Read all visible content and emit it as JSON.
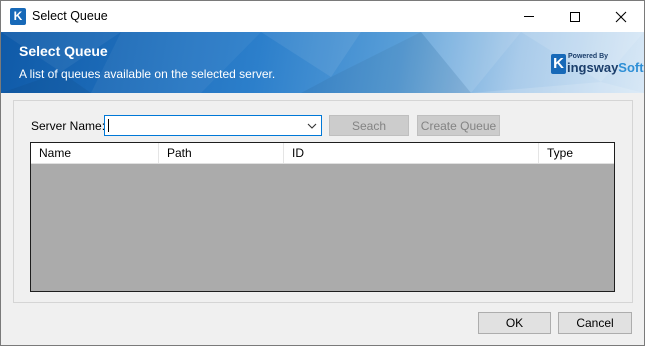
{
  "window": {
    "title": "Select Queue",
    "app_icon_letter": "K",
    "controls": [
      "minimize",
      "maximize",
      "close"
    ]
  },
  "banner": {
    "title": "Select Queue",
    "subtitle": "A list of queues available on the selected server.",
    "logo": {
      "powered": "Powered By",
      "brand_k": "K",
      "brand_main": "ingsway",
      "brand_soft": "Soft"
    }
  },
  "form": {
    "server_label": "Server Name:",
    "server_value": "",
    "search_label": "Seach",
    "create_label": "Create Queue"
  },
  "grid": {
    "columns": [
      "Name",
      "Path",
      "ID",
      "Type"
    ],
    "rows": []
  },
  "footer": {
    "ok_label": "OK",
    "cancel_label": "Cancel"
  },
  "colors": {
    "banner_blue": "#0f5aa8",
    "grid_background": "#ababab",
    "focus_border": "#0078d7"
  }
}
